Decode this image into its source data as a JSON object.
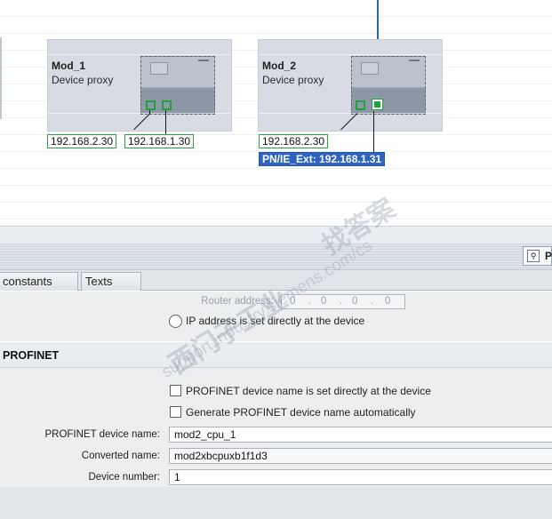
{
  "network": {
    "devices": [
      {
        "id": "mod1",
        "name": "Mod_1",
        "type": "Device proxy",
        "ip_labels": [
          "192.168.2.30",
          "192.168.1.30"
        ]
      },
      {
        "id": "mod2",
        "name": "Mod_2",
        "type": "Device proxy",
        "ip_labels": [
          "192.168.2.30"
        ],
        "selected_label": "PN/IE_Ext:  192.168.1.31"
      }
    ]
  },
  "toolbar": {
    "properties_label": "P",
    "properties_icon": "magnifier-list-icon"
  },
  "tabs": [
    {
      "label": "constants"
    },
    {
      "label": "Texts"
    }
  ],
  "ip_settings": {
    "router_address_label": "Router address:",
    "router_address_value": [
      "0",
      ".",
      "0",
      ".",
      "0",
      ".",
      "0"
    ],
    "radio_label": "IP address is set directly at the device"
  },
  "profinet": {
    "heading": "PROFINET",
    "checkbox_set_directly": "PROFINET device name is set directly at the device",
    "checkbox_generate": "Generate PROFINET device name automatically",
    "device_name_label": "PROFINET device name:",
    "device_name_value": "mod2_cpu_1",
    "converted_name_label": "Converted name:",
    "converted_name_value": "mod2xbcpuxb1f1d3",
    "device_number_label": "Device number:",
    "device_number_value": "1"
  },
  "watermark": {
    "line1": "西门子工业",
    "line2": "找答案",
    "line3": "support.industry.siemens.com/cs"
  },
  "colors": {
    "port_green": "#1ea33a",
    "selection_blue": "#2e63c3",
    "profinet_line": "#2a64b8"
  }
}
